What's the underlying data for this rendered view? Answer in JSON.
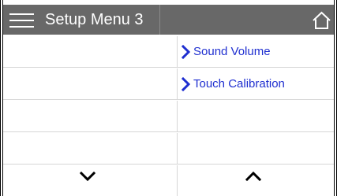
{
  "header": {
    "title": "Setup Menu 3"
  },
  "rows": [
    {
      "right_label": "Sound Volume"
    },
    {
      "right_label": "Touch Calibration"
    },
    {
      "right_label": ""
    },
    {
      "right_label": ""
    }
  ],
  "icons": {
    "menu": "hamburger-menu-icon",
    "home": "home-icon",
    "row_chevron": "chevron-right-icon",
    "down": "chevron-down-icon",
    "up": "chevron-up-icon"
  },
  "colors": {
    "header_bg": "#686868",
    "header_text": "#ffffff",
    "link_text": "#1f2fd0",
    "grid_lines": "#d6d6d6"
  }
}
